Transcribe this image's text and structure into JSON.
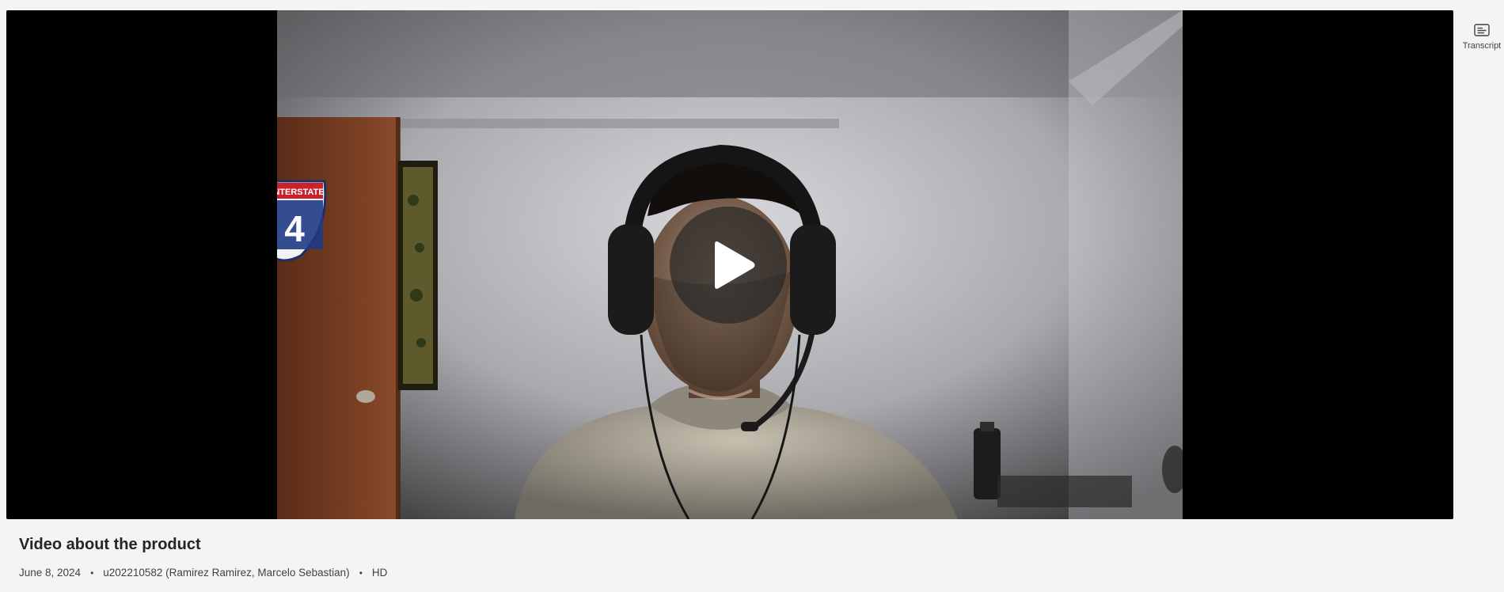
{
  "sidebar": {
    "transcript_label": "Transcript",
    "transcript_icon": "transcript-icon"
  },
  "player": {
    "play_icon": "play-icon",
    "sign_text": "INTERSTATE",
    "sign_number": "4"
  },
  "video": {
    "title": "Video about the product",
    "date": "June 8, 2024",
    "separator": "•",
    "owner": "u202210582 (Ramirez Ramirez, Marcelo Sebastian)",
    "quality": "HD"
  },
  "colors": {
    "page_background": "#f4f4f4",
    "player_background": "#000000",
    "play_button": "rgba(40,40,40,0.72)"
  }
}
